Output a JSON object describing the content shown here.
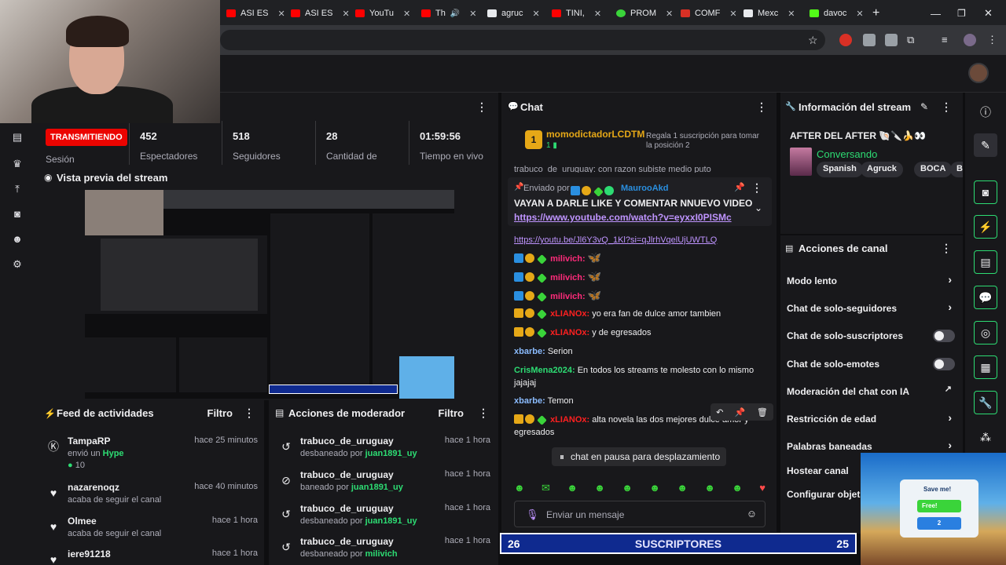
{
  "browser": {
    "tabs": [
      {
        "label": "ASI ES",
        "icon": "youtube-icon"
      },
      {
        "label": "ASI ES",
        "icon": "youtube-icon"
      },
      {
        "label": "YouTu",
        "icon": "youtube-icon"
      },
      {
        "label": "Th",
        "icon": "youtube-icon"
      },
      {
        "label": "agruc",
        "icon": "generic-icon"
      },
      {
        "label": "TINI,",
        "icon": "youtube-icon"
      },
      {
        "label": "PROM",
        "icon": "generic-icon"
      },
      {
        "label": "COMF",
        "icon": "generic-icon"
      },
      {
        "label": "Mexc",
        "icon": "generic-icon"
      },
      {
        "label": "davoc",
        "icon": "kick-icon"
      }
    ],
    "new_tab": "+"
  },
  "stats": {
    "live_label": "TRANSMITIENDO",
    "session_label": "Sesión",
    "viewers": "452",
    "viewers_label": "Espectadores",
    "followers": "518",
    "followers_label": "Seguidores",
    "count": "28",
    "count_label": "Cantidad de",
    "uptime": "01:59:56",
    "uptime_label": "Tiempo en vivo"
  },
  "preview": {
    "title": "Vista previa del stream"
  },
  "feed": {
    "title": "Feed de actividades",
    "filter": "Filtro",
    "items": [
      {
        "user": "TampaRP",
        "text": "envió un",
        "highlight": "Hype",
        "extra": "10",
        "time": "hace 25 minutos"
      },
      {
        "user": "nazarenoqz",
        "text": "acaba de seguir el canal",
        "time": "hace 40 minutos"
      },
      {
        "user": "Olmee",
        "text": "acaba de seguir el canal",
        "time": "hace 1 hora"
      },
      {
        "user": "iere91218",
        "text": "",
        "time": "hace 1 hora"
      }
    ]
  },
  "modactions": {
    "title": "Acciones de moderador",
    "filter": "Filtro",
    "items": [
      {
        "user": "trabuco_de_uruguay",
        "text": "desbaneado por",
        "mod": "juan1891_uy",
        "time": "hace 1 hora"
      },
      {
        "user": "trabuco_de_uruguay",
        "text": "baneado por",
        "mod": "juan1891_uy",
        "time": "hace 1 hora"
      },
      {
        "user": "trabuco_de_uruguay",
        "text": "desbaneado por",
        "mod": "juan1891_uy",
        "time": "hace 1 hora"
      },
      {
        "user": "trabuco_de_uruguay",
        "text": "desbaneado por",
        "mod": "milivich",
        "time": "hace 1 hora"
      }
    ]
  },
  "chat": {
    "title": "Chat",
    "top_gifter": "momodictadorLCDTM",
    "top_gifter_count": "1",
    "gift_cta": "Regala 1 suscripción para tomar la posición 2",
    "pinned_by_label": "Enviado por",
    "pinned_by": "MaurooAkd",
    "pinned_text": "VAYAN A DARLE LIKE Y COMENTAR NNUEVO VIDEO",
    "pinned_link": "https://www.youtube.com/watch?v=eyxxI0PISMc",
    "partial_top": "trabuco_de_uruguay: con razon subiste medio puto",
    "partial_link": "https://youtu.be/Jl6Y3vQ_1Kl?si=qJlrhVqelUjUWTLQ",
    "messages": [
      {
        "user": "milivich:",
        "text": "",
        "color": "pink"
      },
      {
        "user": "milivich:",
        "text": "",
        "color": "pink"
      },
      {
        "user": "milivich:",
        "text": "",
        "color": "pink"
      },
      {
        "user": "xLIANOx:",
        "text": "yo era fan de dulce amor tambien",
        "color": "red"
      },
      {
        "user": "xLIANOx:",
        "text": "y de egresados",
        "color": "red"
      },
      {
        "user": "xbarbe:",
        "text": "Serion",
        "color": "blue"
      },
      {
        "user": "CrisMena2024:",
        "text": "En todos los streams te molesto con lo mismo jajajaj",
        "color": "green"
      },
      {
        "user": "xbarbe:",
        "text": "Temon",
        "color": "blue"
      },
      {
        "user": "xLIANOx:",
        "text": "alta novela las dos mejores dulce amor y egresados",
        "color": "red"
      }
    ],
    "paused": "chat en pausa para desplazamiento",
    "input_placeholder": "Enviar un mensaje"
  },
  "info": {
    "title": "Información del stream",
    "stream_title": "AFTER DEL AFTER 🐚🔪🍌👀",
    "category": "Conversando",
    "tags": [
      "Spanish",
      "Agruck",
      "BOCA",
      "BC"
    ]
  },
  "actions": {
    "title": "Acciones de canal",
    "items": [
      {
        "label": "Modo lento",
        "control": "chevron"
      },
      {
        "label": "Chat de solo-seguidores",
        "control": "chevron"
      },
      {
        "label": "Chat de solo-suscriptores",
        "control": "toggle"
      },
      {
        "label": "Chat de solo-emotes",
        "control": "toggle"
      },
      {
        "label": "Moderación del chat con IA",
        "control": "external"
      },
      {
        "label": "Restricción de edad",
        "control": "chevron"
      },
      {
        "label": "Palabras baneadas",
        "control": "chevron"
      },
      {
        "label": "Hostear canal",
        "control": "none"
      },
      {
        "label": "Configurar objetivo",
        "control": "none"
      }
    ]
  },
  "subbar": {
    "left": "26",
    "label": "SUSCRIPTORES",
    "right": "25"
  },
  "game": {
    "card_title": "Save me!",
    "free": "Free!",
    "count": "2"
  },
  "colors": {
    "accent": "#2ddc73",
    "live": "#eb0400",
    "subbar": "#0f2a8f"
  }
}
